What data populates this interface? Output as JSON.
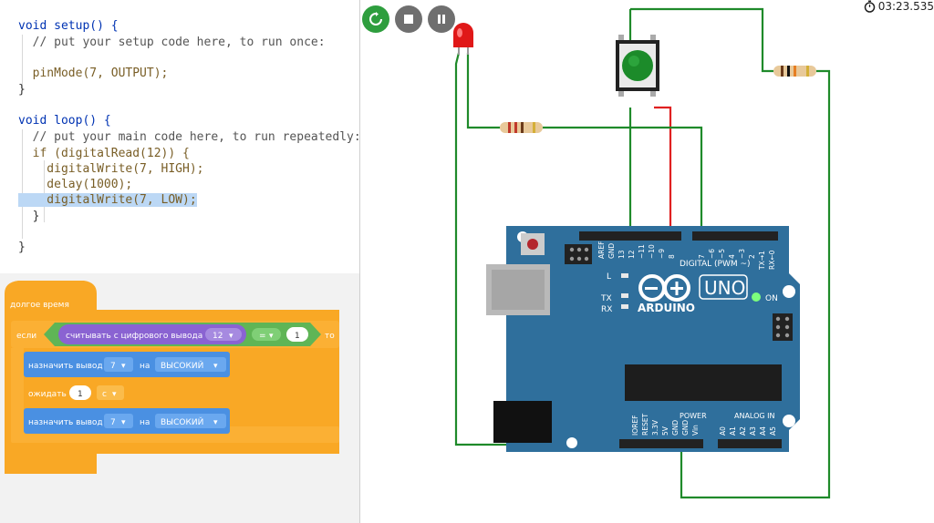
{
  "code": {
    "lines": [
      "void setup() {",
      "  // put your setup code here, to run once:",
      "",
      "  pinMode(7, OUTPUT);",
      "}",
      "",
      "void loop() {",
      "  // put your main code here, to run repeatedly:",
      "  if (digitalRead(12)) {",
      "    digitalWrite(7, HIGH);",
      "    delay(1000);",
      "    digitalWrite(7, LOW);",
      "  }",
      "",
      "}"
    ]
  },
  "blocks": {
    "forever_label": "долгое время",
    "if_label": "если",
    "read_label": "считывать с цифрового вывода",
    "read_pin": "12",
    "compare_op": "=",
    "compare_value": "1",
    "then_label": "то",
    "set1_label": "назначить вывод",
    "set1_pin": "7",
    "set1_to": "на",
    "set1_value": "ВЫСОКИЙ",
    "wait_label": "ожидать",
    "wait_value": "1",
    "wait_unit": "с",
    "set2_label": "назначить вывод",
    "set2_pin": "7",
    "set2_to": "на",
    "set2_value": "ВЫСОКИЙ"
  },
  "sim": {
    "timer": "03:23.535"
  },
  "board": {
    "uno_label": "UNO",
    "arduino_label": "ARDUINO",
    "on_label": "ON",
    "digital_label": "DIGITAL (PWM ~)",
    "tx_label": "TX",
    "rx_label": "RX",
    "l_label": "L",
    "power_label": "POWER",
    "analog_label": "ANALOG IN",
    "top_pins": [
      "AREF",
      "GND",
      "13",
      "12",
      "~11",
      "~10",
      "~9",
      "8",
      "7",
      "~6",
      "~5",
      "4",
      "~3",
      "2",
      "TX→1",
      "RX←0"
    ],
    "bottom_pins": [
      "IOREF",
      "RESET",
      "3.3V",
      "5V",
      "GND",
      "GND",
      "Vin"
    ],
    "analog_pins": [
      "A0",
      "A1",
      "A2",
      "A3",
      "A4",
      "A5"
    ]
  },
  "colors": {
    "board": "#2f6f9c",
    "block_orange": "#f9a825",
    "block_purple": "#8a63d2",
    "block_green": "#5fb556",
    "block_blue": "#4a90e2",
    "wire_green": "#1f8a2a",
    "wire_red": "#e02020"
  }
}
